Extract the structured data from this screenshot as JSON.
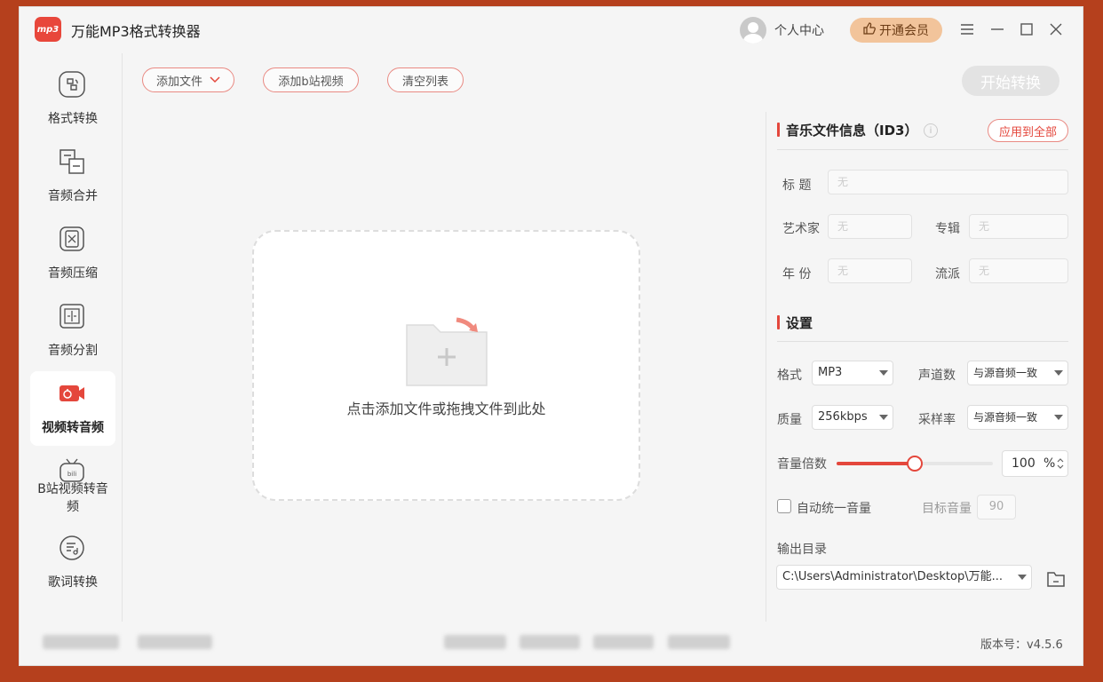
{
  "app": {
    "logo_text": "mp3",
    "title": "万能MP3格式转换器",
    "user_center": "个人中心",
    "vip_label": "开通会员"
  },
  "window_controls": [
    "menu-icon",
    "minimize-icon",
    "maximize-icon",
    "close-icon"
  ],
  "sidebar": {
    "items": [
      {
        "label": "格式转换",
        "icon": "format-convert-icon",
        "active": false
      },
      {
        "label": "音频合并",
        "icon": "audio-merge-icon",
        "active": false
      },
      {
        "label": "音频压缩",
        "icon": "audio-compress-icon",
        "active": false
      },
      {
        "label": "音频分割",
        "icon": "audio-split-icon",
        "active": false
      },
      {
        "label": "视频转音频",
        "icon": "video-to-audio-icon",
        "active": true
      },
      {
        "label": "B站视频转音频",
        "icon": "bilibili-icon",
        "active": false
      },
      {
        "label": "歌词转换",
        "icon": "lyrics-icon",
        "active": false
      }
    ]
  },
  "toolbar": {
    "add_file": "添加文件",
    "add_bilibili": "添加b站视频",
    "clear_list": "清空列表",
    "start": "开始转换"
  },
  "dropzone": {
    "text": "点击添加文件或拖拽文件到此处"
  },
  "id3": {
    "title": "音乐文件信息（ID3）",
    "apply_all": "应用到全部",
    "fields": {
      "title_label": "标  题",
      "artist_label": "艺术家",
      "album_label": "专辑",
      "year_label": "年  份",
      "genre_label": "流派",
      "placeholder": "无"
    }
  },
  "settings": {
    "title": "设置",
    "format_label": "格式",
    "format_value": "MP3",
    "channels_label": "声道数",
    "channels_value": "与源音频一致",
    "quality_label": "质量",
    "quality_value": "256kbps",
    "samplerate_label": "采样率",
    "samplerate_value": "与源音频一致",
    "volume_label": "音量倍数",
    "volume_value": "100",
    "volume_unit": "%",
    "volume_fraction": 0.5,
    "auto_volume_label": "自动统一音量",
    "auto_volume_checked": false,
    "target_volume_label": "目标音量",
    "target_volume_value": "90",
    "output_label": "输出目录",
    "output_path": "C:\\Users\\Administrator\\Desktop\\万能..."
  },
  "footer": {
    "version": "版本号：v4.5.6"
  },
  "colors": {
    "accent": "#e4473c",
    "frame": "#b5401d",
    "vip": "#f2c49b"
  }
}
